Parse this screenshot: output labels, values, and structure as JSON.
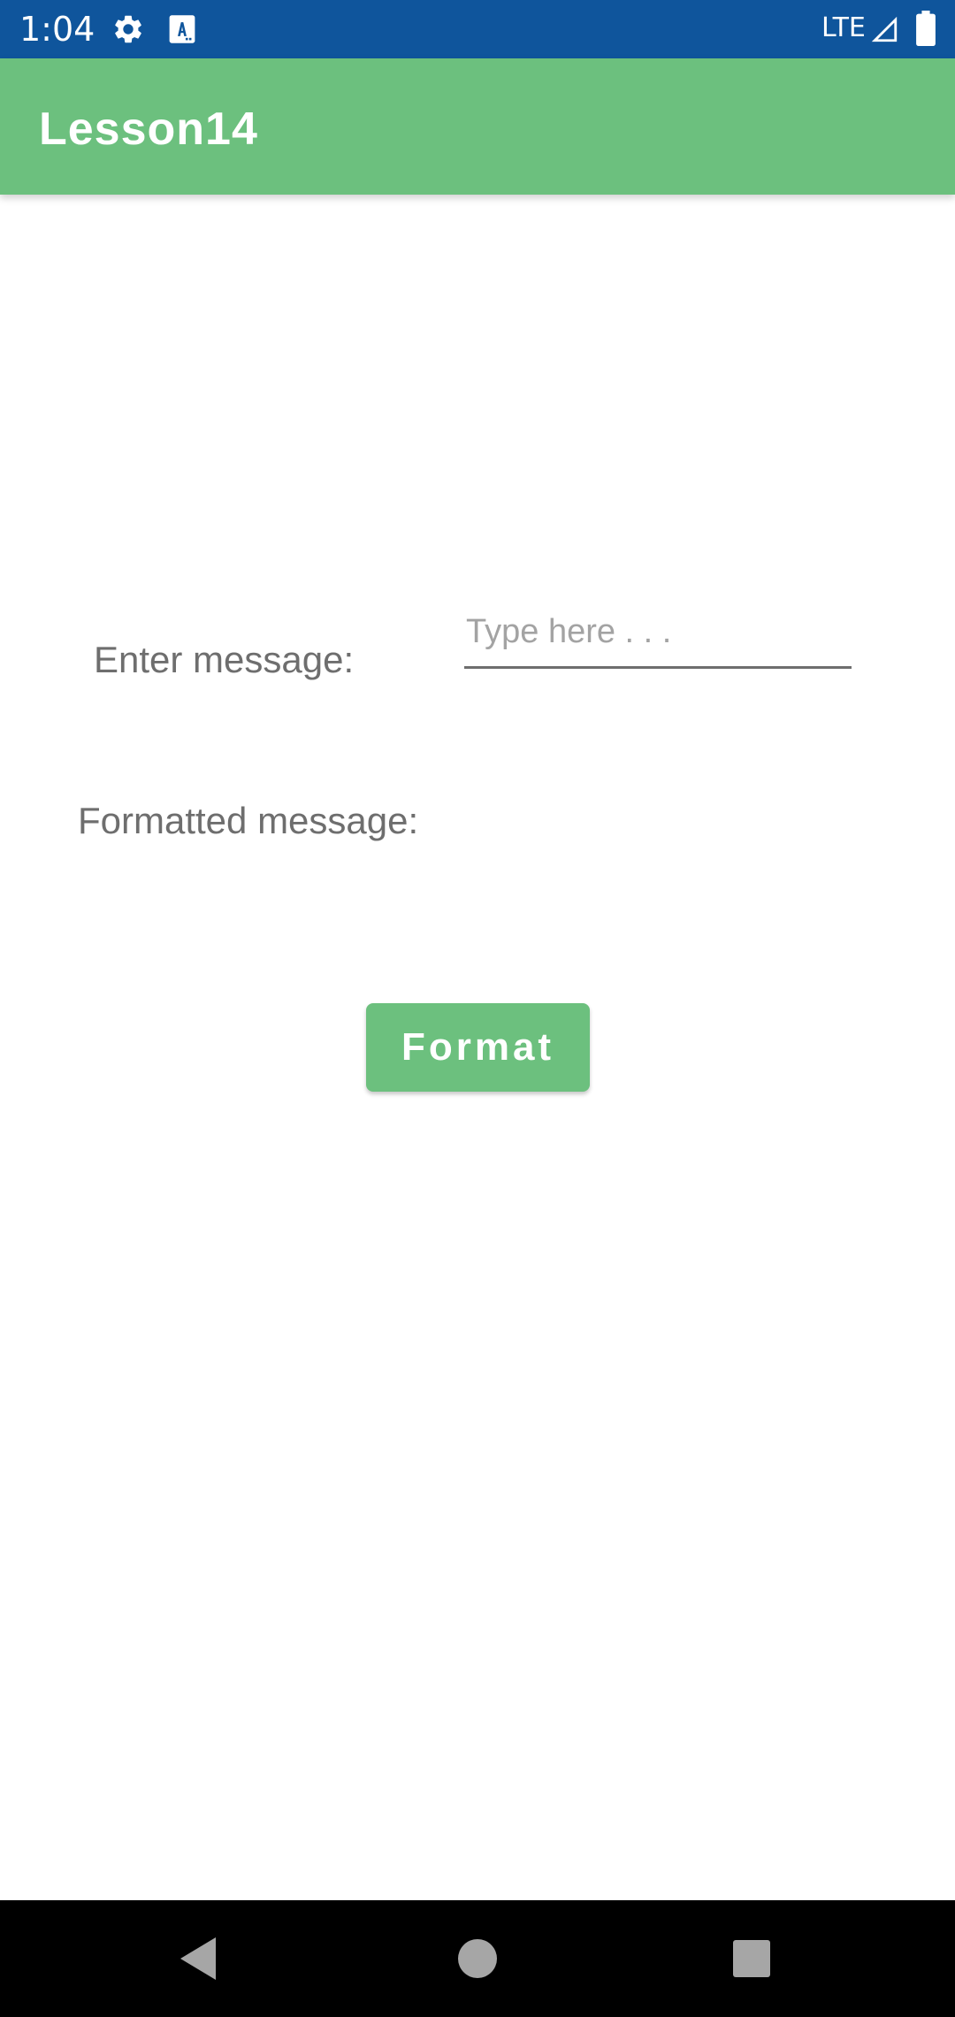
{
  "status_bar": {
    "time": "1:04",
    "network": "LTE",
    "icons": [
      "gear-icon",
      "a-notification-icon",
      "signal-icon",
      "battery-icon"
    ]
  },
  "app_bar": {
    "title": "Lesson14"
  },
  "form": {
    "enter_label": "Enter message:",
    "input_value": "",
    "input_placeholder": "Type here . . .",
    "formatted_label": "Formatted message:",
    "formatted_value": "",
    "button_label": "Format"
  },
  "nav_bar": {
    "icons": [
      "back-icon",
      "home-icon",
      "recents-icon"
    ]
  },
  "colors": {
    "status_bar": "#0f559c",
    "accent": "#6cc07e",
    "label_text": "#6e6e6e",
    "placeholder_text": "#a3a3a3",
    "nav_bar": "#000000"
  }
}
